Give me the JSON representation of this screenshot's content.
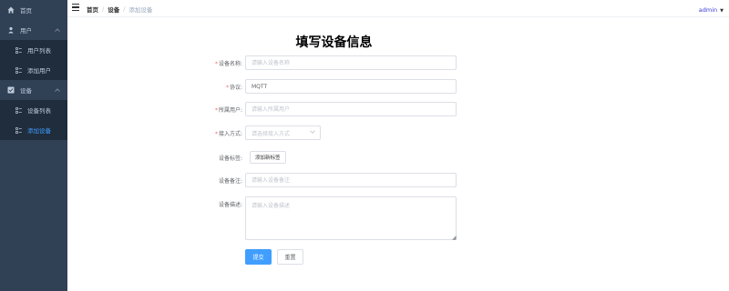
{
  "sidebar": {
    "items": [
      {
        "label": "首页",
        "icon": "home-icon"
      },
      {
        "label": "用户",
        "icon": "user-icon"
      },
      {
        "label": "用户列表",
        "icon": "list-icon"
      },
      {
        "label": "添加用户",
        "icon": "list-icon"
      },
      {
        "label": "设备",
        "icon": "device-icon"
      },
      {
        "label": "设备列表",
        "icon": "list-icon"
      },
      {
        "label": "添加设备",
        "icon": "list-icon"
      }
    ]
  },
  "header": {
    "breadcrumb": [
      "首页",
      "设备",
      "添加设备"
    ],
    "separator": "/",
    "user": "admin"
  },
  "form": {
    "title": "填写设备信息",
    "name": {
      "label": "设备名称:",
      "placeholder": "请输入设备名称"
    },
    "protocol": {
      "label": "协议:",
      "value": "MQTT"
    },
    "owner": {
      "label": "所属用户:",
      "placeholder": "请输入所属用户"
    },
    "access": {
      "label": "接入方式:",
      "placeholder": "请选择接入方式"
    },
    "tags": {
      "label": "设备标签:",
      "button": "添加新标签"
    },
    "remark": {
      "label": "设备备注:",
      "placeholder": "请输入设备备注"
    },
    "description": {
      "label": "设备描述:",
      "placeholder": "请输入设备描述"
    },
    "submit": "提交",
    "reset": "重置"
  },
  "colors": {
    "sidebar": "#304156",
    "submenu": "#1f2d3d",
    "accent": "#409eff",
    "required": "#f56c6c"
  }
}
